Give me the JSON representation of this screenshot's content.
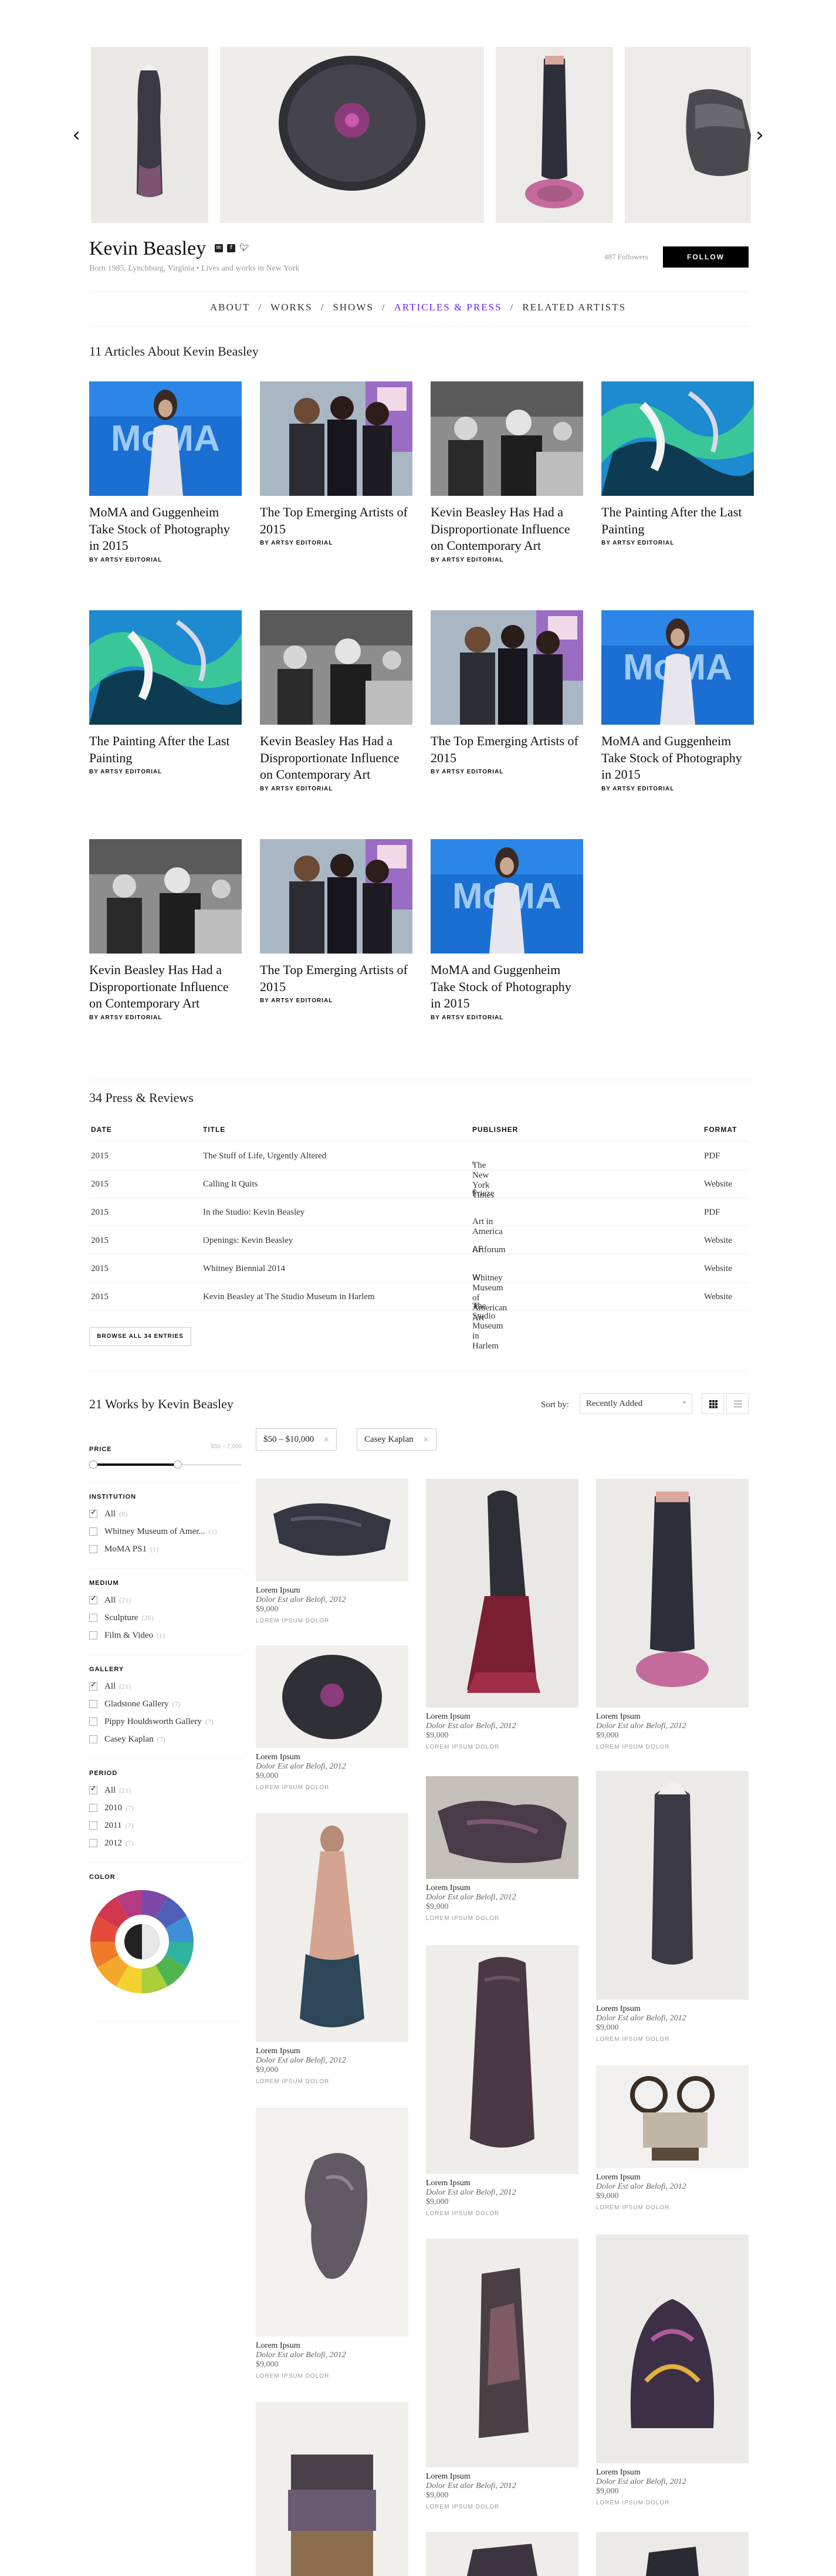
{
  "artist": {
    "name": "Kevin Beasley",
    "bio": "Born 1985, Lynchburg, Virginia • Lives and works in New York",
    "followers": "487 Followers",
    "follow_label": "FOLLOW"
  },
  "nav": {
    "about": "ABOUT",
    "works": "WORKS",
    "shows": "SHOWS",
    "articles": "ARTICLES & PRESS",
    "related": "RELATED ARTISTS",
    "separator": "/"
  },
  "articles": {
    "heading": "11 Articles About Kevin Beasley",
    "items": [
      {
        "title": "MoMA and Guggenheim Take Stock of Photography in 2015",
        "author": "BY ARTSY EDITORIAL",
        "thumb": "moma"
      },
      {
        "title": "The Top Emerging Artists of 2015",
        "author": "BY ARTSY EDITORIAL",
        "thumb": "trio"
      },
      {
        "title": "Kevin Beasley Has Had a Disproportionate Influence on Contemporary Art",
        "author": "BY ARTSY EDITORIAL",
        "thumb": "bw"
      },
      {
        "title": "The Painting After the Last Painting",
        "author": "BY ARTSY EDITORIAL",
        "thumb": "abstract"
      },
      {
        "title": "The Painting After the Last Painting",
        "author": "BY ARTSY EDITORIAL",
        "thumb": "abstract"
      },
      {
        "title": "Kevin Beasley Has Had a Disproportionate Influence on Contemporary Art",
        "author": "BY ARTSY EDITORIAL",
        "thumb": "bw"
      },
      {
        "title": "The Top Emerging Artists of 2015",
        "author": "BY ARTSY EDITORIAL",
        "thumb": "trio"
      },
      {
        "title": "MoMA and Guggenheim Take Stock of Photography in 2015",
        "author": "BY ARTSY EDITORIAL",
        "thumb": "moma"
      },
      {
        "title": "Kevin Beasley Has Had a Disproportionate Influence on Contemporary Art",
        "author": "BY ARTSY EDITORIAL",
        "thumb": "bw"
      },
      {
        "title": "The Top Emerging Artists of 2015",
        "author": "BY ARTSY EDITORIAL",
        "thumb": "trio"
      },
      {
        "title": "MoMA and Guggenheim Take Stock of Photography in 2015",
        "author": "BY ARTSY EDITORIAL",
        "thumb": "moma"
      }
    ]
  },
  "press": {
    "heading": "34 Press & Reviews",
    "columns": {
      "date": "DATE",
      "title": "TITLE",
      "publisher": "PUBLISHER",
      "format": "FORMAT"
    },
    "rows": [
      {
        "date": "2015",
        "title": "The Stuff of Life, Urgently Altered",
        "icon": "ᵗ",
        "publisher": "The New York Times",
        "format": "PDF"
      },
      {
        "date": "2015",
        "title": "Calling It Quits",
        "icon": "f",
        "publisher": "Frieze",
        "format": "Website"
      },
      {
        "date": "2015",
        "title": "In the Studio: Kevin Beasley",
        "icon": "",
        "publisher": "Art in America",
        "format": "PDF"
      },
      {
        "date": "2015",
        "title": "Openings: Kevin Beasley",
        "icon": "AF",
        "publisher": "Artforum",
        "format": "Website"
      },
      {
        "date": "2015",
        "title": "Whitney Biennial 2014",
        "icon": "W",
        "publisher": "Whitney Museum of American Art",
        "format": "Website"
      },
      {
        "date": "2015",
        "title": "Kevin Beasley at The Studio Museum in Harlem",
        "icon": "✶",
        "publisher": "The Studio Museum in Harlem",
        "format": "Website"
      }
    ],
    "browse_label": "BROWSE ALL 34 ENTRIES"
  },
  "works": {
    "heading": "21 Works by Kevin Beasley",
    "sort_label": "Sort by:",
    "sort_value": "Recently Added",
    "filters": [
      "$50 – $10,000",
      "Casey Kaplan"
    ],
    "sidebar": {
      "price": {
        "title": "PRICE",
        "range": "$50 – 7,000"
      },
      "institution": {
        "title": "INSTITUTION",
        "options": [
          {
            "label": "All",
            "count": "(8)",
            "checked": true
          },
          {
            "label": "Whitney Museum of Amer...",
            "count": "(1)",
            "checked": false
          },
          {
            "label": "MoMA PS1",
            "count": "(1)",
            "checked": false
          }
        ]
      },
      "medium": {
        "title": "MEDIUM",
        "options": [
          {
            "label": "All",
            "count": "(21)",
            "checked": true
          },
          {
            "label": "Sculpture",
            "count": "(20)",
            "checked": false
          },
          {
            "label": "Film & Video",
            "count": "(1)",
            "checked": false
          }
        ]
      },
      "gallery": {
        "title": "GALLERY",
        "options": [
          {
            "label": "All",
            "count": "(21)",
            "checked": true
          },
          {
            "label": "Gladstone Gallery",
            "count": "(7)",
            "checked": false
          },
          {
            "label": "Pippy Houldsworth Gallery",
            "count": "(7)",
            "checked": false
          },
          {
            "label": "Casey Kaplan",
            "count": "(7)",
            "checked": false
          }
        ]
      },
      "period": {
        "title": "PERIOD",
        "options": [
          {
            "label": "All",
            "count": "(21)",
            "checked": true
          },
          {
            "label": "2010",
            "count": "(7)",
            "checked": false
          },
          {
            "label": "2011",
            "count": "(7)",
            "checked": false
          },
          {
            "label": "2012",
            "count": "(7)",
            "checked": false
          }
        ]
      },
      "color": {
        "title": "COLOR"
      }
    },
    "item_text": {
      "artist": "Lorem Ipsum",
      "title": "Dolor Est alor Belofi, 2012",
      "price": "$9,000",
      "gallery": "LOREM IPSUM DOLOR"
    }
  }
}
